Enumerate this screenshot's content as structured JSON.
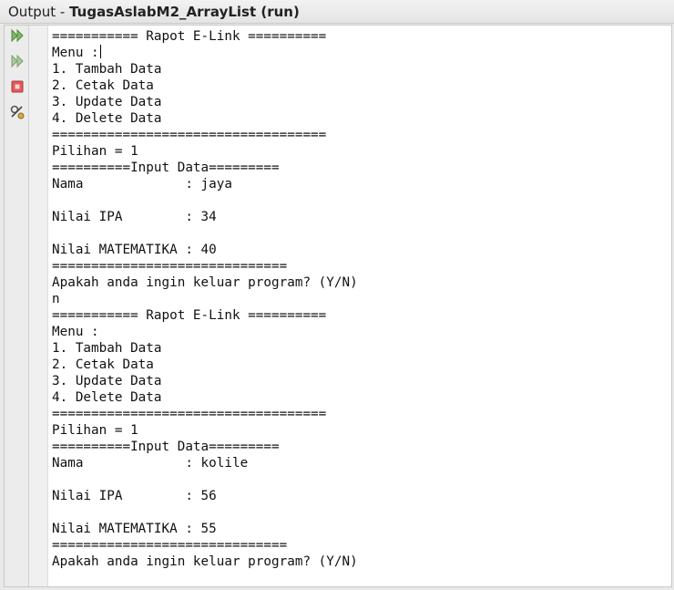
{
  "window": {
    "title_prefix": "Output - ",
    "project": "TugasAslabM2_ArrayList (run)"
  },
  "toolbar": {
    "run": "rerun-icon",
    "rerun_modified": "rerun-different-params-icon",
    "stop": "stop-icon",
    "settings": "output-settings-icon"
  },
  "console": {
    "lines": [
      "=========== Rapot E-Link ==========",
      "Menu :",
      "1. Tambah Data",
      "2. Cetak Data",
      "3. Update Data",
      "4. Delete Data",
      "===================================",
      "Pilihan = 1",
      "==========Input Data=========",
      "Nama             : jaya",
      "",
      "Nilai IPA        : 34",
      "",
      "Nilai MATEMATIKA : 40",
      "==============================",
      "Apakah anda ingin keluar program? (Y/N)",
      "n",
      "=========== Rapot E-Link ==========",
      "Menu :",
      "1. Tambah Data",
      "2. Cetak Data",
      "3. Update Data",
      "4. Delete Data",
      "===================================",
      "Pilihan = 1",
      "==========Input Data=========",
      "Nama             : kolile",
      "",
      "Nilai IPA        : 56",
      "",
      "Nilai MATEMATIKA : 55",
      "==============================",
      "Apakah anda ingin keluar program? (Y/N)"
    ]
  }
}
